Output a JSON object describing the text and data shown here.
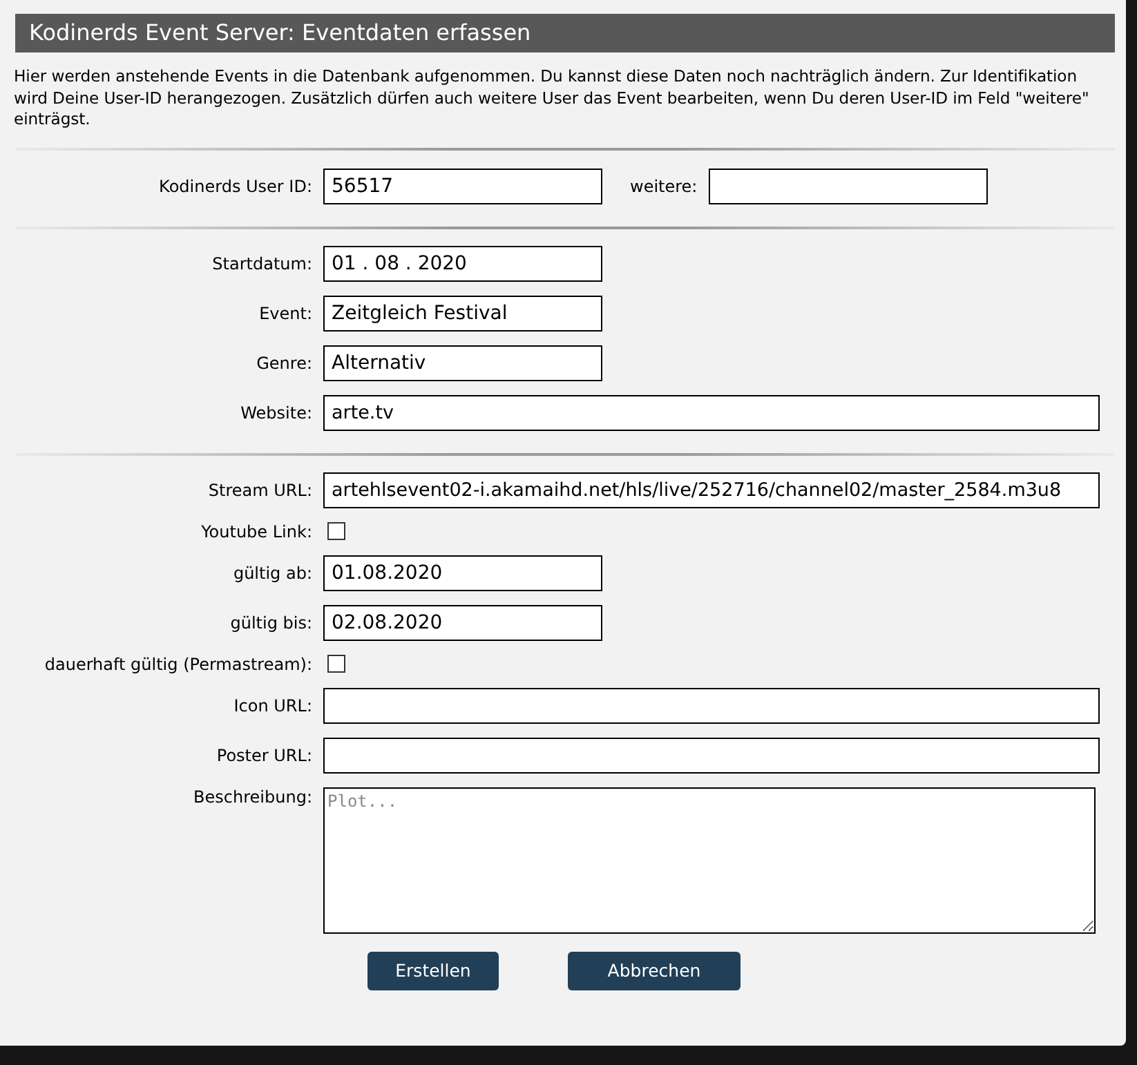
{
  "title": "Kodinerds Event Server: Eventdaten erfassen",
  "intro": "Hier werden anstehende Events in die Datenbank aufgenommen. Du kannst diese Daten noch nachträglich ändern. Zur Identifikation wird Deine User-ID herangezogen. Zusätzlich dürfen auch weitere User das Event bearbeiten, wenn Du deren User-ID im Feld \"weitere\" einträgst.",
  "user_row": {
    "label": "Kodinerds User ID:",
    "value": "56517",
    "other_label": "weitere:"
  },
  "sections": [
    {
      "fields": [
        {
          "kind": "short",
          "label": "Startdatum:",
          "value": "01 . 08 . 2020"
        },
        {
          "kind": "short",
          "label": "Event:",
          "value": "Zeitgleich Festival"
        },
        {
          "kind": "short",
          "label": "Genre:",
          "value": "Alternativ"
        },
        {
          "kind": "long",
          "label": "Website:",
          "value": "arte.tv"
        }
      ]
    },
    {
      "fields": [
        {
          "kind": "long",
          "label": "Stream URL:",
          "value": "artehlsevent02-i.akamaihd.net/hls/live/252716/channel02/master_2584.m3u8"
        },
        {
          "kind": "checkbox",
          "label": "Youtube Link:",
          "checked": false
        },
        {
          "kind": "short",
          "label": "gültig ab:",
          "value": "01.08.2020"
        },
        {
          "kind": "short",
          "label": "gültig bis:",
          "value": "02.08.2020"
        },
        {
          "kind": "checkbox",
          "label": "dauerhaft gültig (Permastream):",
          "checked": false
        },
        {
          "kind": "long",
          "label": "Icon URL:"
        },
        {
          "kind": "long",
          "label": "Poster URL:"
        },
        {
          "kind": "textarea",
          "label": "Beschreibung:",
          "placeholder": "Plot..."
        }
      ]
    }
  ],
  "buttons": [
    "Erstellen",
    "Abbrechen"
  ]
}
